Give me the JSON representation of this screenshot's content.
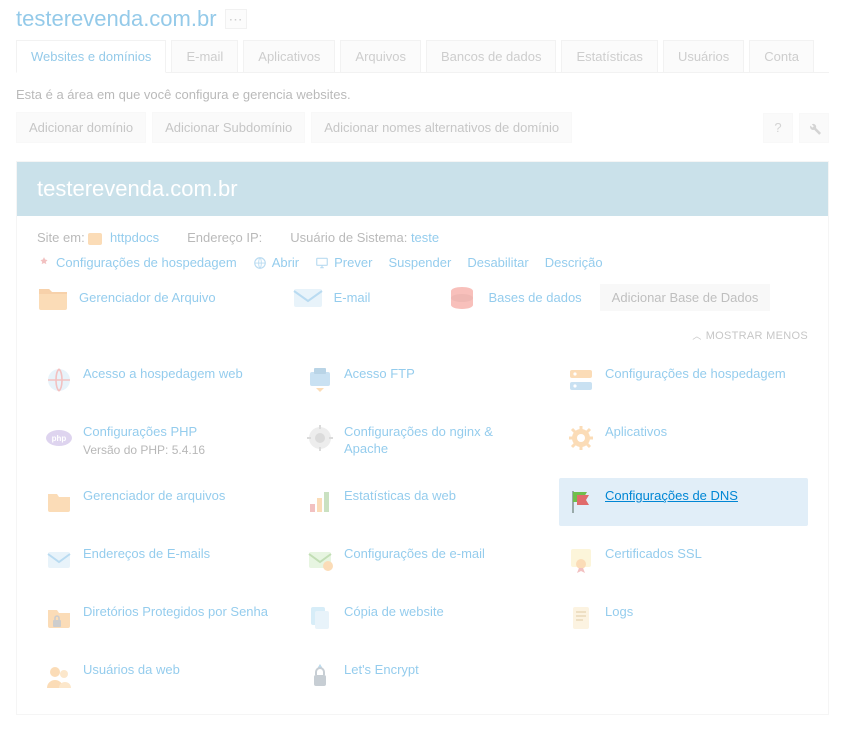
{
  "page": {
    "title": "testerevenda.com.br"
  },
  "tabs": [
    {
      "label": "Websites e domínios",
      "active": true
    },
    {
      "label": "E-mail"
    },
    {
      "label": "Aplicativos"
    },
    {
      "label": "Arquivos"
    },
    {
      "label": "Bancos de dados"
    },
    {
      "label": "Estatísticas"
    },
    {
      "label": "Usuários"
    },
    {
      "label": "Conta"
    }
  ],
  "intro": "Esta é a área em que você configura e gerencia websites.",
  "actions": {
    "add_domain": "Adicionar domínio",
    "add_subdomain": "Adicionar Subdomínio",
    "add_alias": "Adicionar nomes alternativos de domínio"
  },
  "domain": {
    "name": "testerevenda.com.br",
    "site_in_label": "Site em:",
    "site_in_value": "httpdocs",
    "ip_label": "Endereço IP:",
    "user_label": "Usuário de Sistema:",
    "user_value": "teste"
  },
  "settings_links": {
    "hosting_settings": "Configurações de hospedagem",
    "open": "Abrir",
    "preview": "Prever",
    "suspend": "Suspender",
    "disable": "Desabilitar",
    "description": "Descrição"
  },
  "big_links": {
    "file_manager": "Gerenciador de Arquivo",
    "email": "E-mail",
    "databases": "Bases de dados",
    "add_database": "Adicionar Base de Dados"
  },
  "toggle": {
    "show_less": "MOSTRAR MENOS"
  },
  "grid": {
    "web_hosting_access": "Acesso a hospedagem web",
    "ftp_access": "Acesso FTP",
    "hosting_settings": "Configurações de hospedagem",
    "php_settings": "Configurações PHP",
    "php_version": "Versão do PHP: 5.4.16",
    "nginx_apache": "Configurações do nginx & Apache",
    "applications": "Aplicativos",
    "file_manager2": "Gerenciador de arquivos",
    "web_stats": "Estatísticas da web",
    "dns_settings": "Configurações de DNS",
    "email_addresses": "Endereços de E-mails",
    "email_settings": "Configurações de e-mail",
    "ssl_certs": "Certificados SSL",
    "password_dirs": "Diretórios Protegidos por Senha",
    "website_copy": "Cópia de website",
    "logs": "Logs",
    "web_users": "Usuários da web",
    "lets_encrypt": "Let's Encrypt"
  }
}
